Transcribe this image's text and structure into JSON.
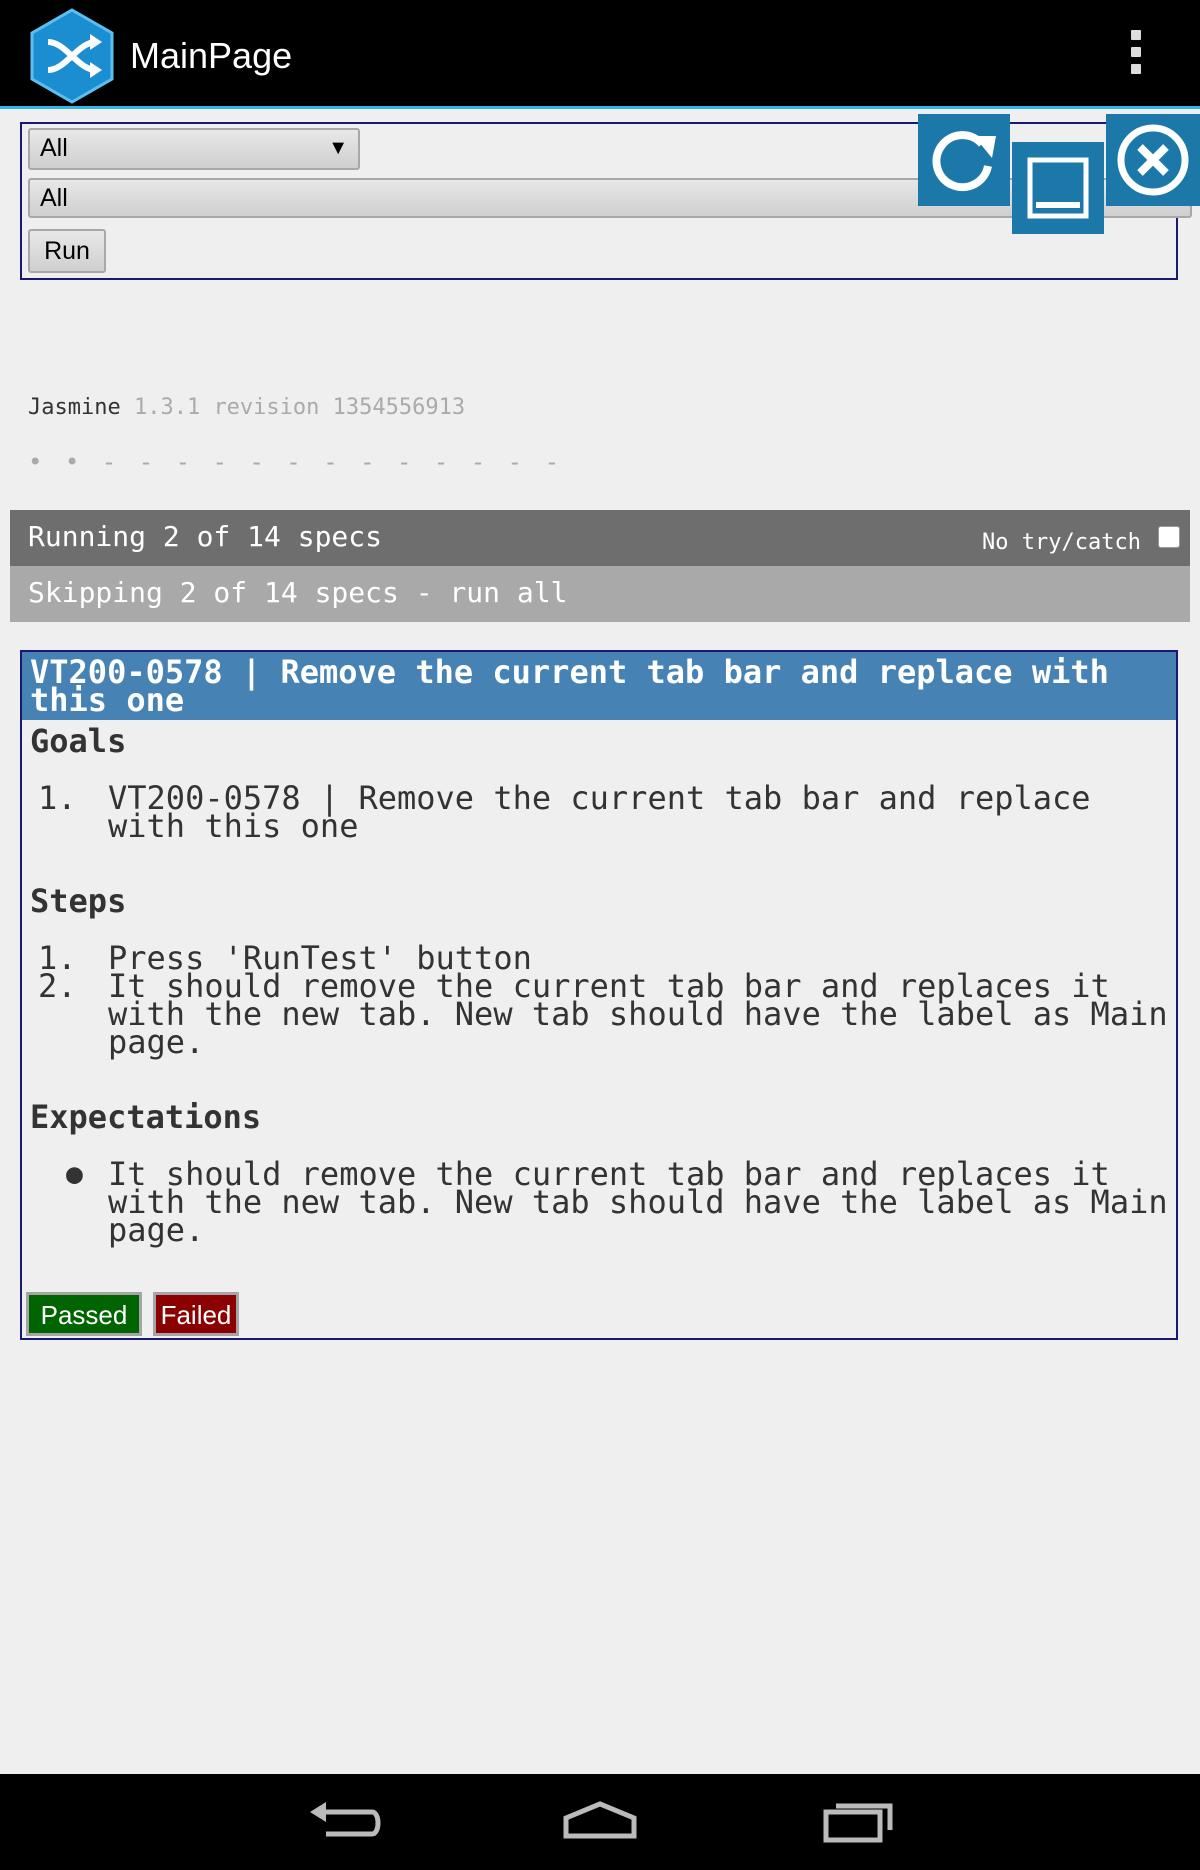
{
  "app": {
    "title": "MainPage"
  },
  "controls": {
    "select_primary": "All",
    "select_secondary": "All",
    "run_label": "Run"
  },
  "jasmine": {
    "name": "Jasmine",
    "version": "1.3.1 revision 1354556913",
    "symbol_summary": "• • - - - - - - - - - - - - -"
  },
  "summary": {
    "running": "Running 2 of 14 specs",
    "no_try_catch": "No try/catch",
    "skipping": "Skipping 2 of 14 specs - run all"
  },
  "spec": {
    "title": "VT200-0578 | Remove the current tab bar and replace with this one",
    "goals_heading": "Goals",
    "goals": [
      {
        "num": "1.",
        "text": "VT200-0578 | Remove the current tab bar and replace with this one"
      }
    ],
    "steps_heading": "Steps",
    "steps": [
      {
        "num": "1.",
        "text": "Press 'RunTest' button"
      },
      {
        "num": "2.",
        "text": "It should remove the current tab bar and replaces it with the new tab. New tab should have the label as Main page."
      }
    ],
    "expectations_heading": "Expectations",
    "expectations": [
      {
        "text": "It should remove the current tab bar and replaces it with the new tab. New tab should have the label as Main page."
      }
    ],
    "passed_label": "Passed",
    "failed_label": "Failed"
  },
  "colors": {
    "accent": "#33b5e5",
    "spec_header": "#4682b4",
    "passed": "#006400",
    "failed": "#8b0000",
    "tool_button": "#1b78a8"
  },
  "icons": [
    "app-logo-icon",
    "overflow-menu-icon",
    "refresh-icon",
    "minimize-icon",
    "close-icon",
    "back-icon",
    "home-icon",
    "recent-apps-icon"
  ]
}
